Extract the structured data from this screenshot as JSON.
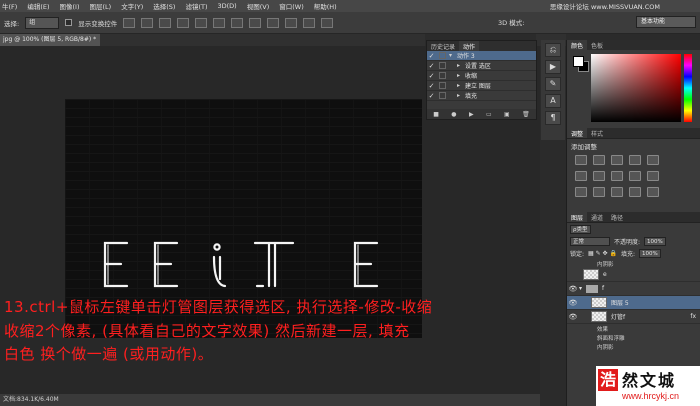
{
  "menu": [
    "文件(F)",
    "编辑(E)",
    "图像(I)",
    "图层(L)",
    "文字(Y)",
    "选择(S)",
    "滤镜(T)",
    "3D(D)",
    "视图(V)",
    "窗口(W)",
    "帮助(H)"
  ],
  "menu_visible": [
    "牛(F)",
    "编辑(E)",
    "图像(I)",
    "图层(L)",
    "文字(Y)",
    "选择(S)",
    "滤镜(T)",
    "3D(D)",
    "视图(V)",
    "窗口(W)",
    "帮助(H)"
  ],
  "watermark_top": "思缘设计论坛 www.MISSVUAN.COM",
  "options": {
    "select_label": "选择:",
    "select_value": "组",
    "show_transform": "显示变换控件",
    "mode3d": "3D 模式:",
    "workspace": "基本功能"
  },
  "document": {
    "tab": "jpg @ 100% (图层 5, RGB/8#) *",
    "status": "文档:834.1K/6.40M",
    "canvas_text": "EEITE"
  },
  "annotation": {
    "line1": "13.ctrl+鼠标左键单击灯管图层获得选区, 执行选择-修改-收缩",
    "line2": "收缩2个像素, (具体看自己的文字效果) 然后新建一层, 填充",
    "line3": "白色 换个做一遍 (或用动作)。"
  },
  "actions_panel": {
    "tabs": [
      "历史记录",
      "动作"
    ],
    "rows": [
      {
        "label": "动作 3",
        "check": "✓"
      },
      {
        "label": "设置 选区",
        "check": "✓"
      },
      {
        "label": "收缩",
        "check": "✓"
      },
      {
        "label": "建立 图层",
        "check": "✓"
      },
      {
        "label": "填充",
        "check": "✓"
      }
    ]
  },
  "color_panel": {
    "tabs": [
      "颜色",
      "色板"
    ],
    "fg": "#ffffff",
    "bg": "#000000"
  },
  "adjustments_panel": {
    "tabs": [
      "调整",
      "样式"
    ],
    "title": "添加调整"
  },
  "layers_panel": {
    "tabs": [
      "图层",
      "通道",
      "路径"
    ],
    "filter": "ρ类型",
    "blend": "正常",
    "opacity_label": "不透明度:",
    "opacity": "100%",
    "lock_label": "锁定:",
    "fill_label": "填充:",
    "fill": "100%",
    "layers": [
      {
        "name": "内阴影",
        "type": "sub"
      },
      {
        "name": "e",
        "type": "layer"
      },
      {
        "name": "f",
        "type": "folder"
      },
      {
        "name": "图层 5",
        "type": "layer",
        "selected": true
      },
      {
        "name": "灯管f",
        "type": "layer",
        "fx": "fx"
      },
      {
        "name": "效果",
        "type": "sub"
      },
      {
        "name": "斜面和浮雕",
        "type": "sub"
      },
      {
        "name": "内阴影",
        "type": "sub"
      }
    ]
  },
  "logo": {
    "seal": "浩",
    "text": "然文城",
    "url": "www.hrcykj.cn"
  }
}
